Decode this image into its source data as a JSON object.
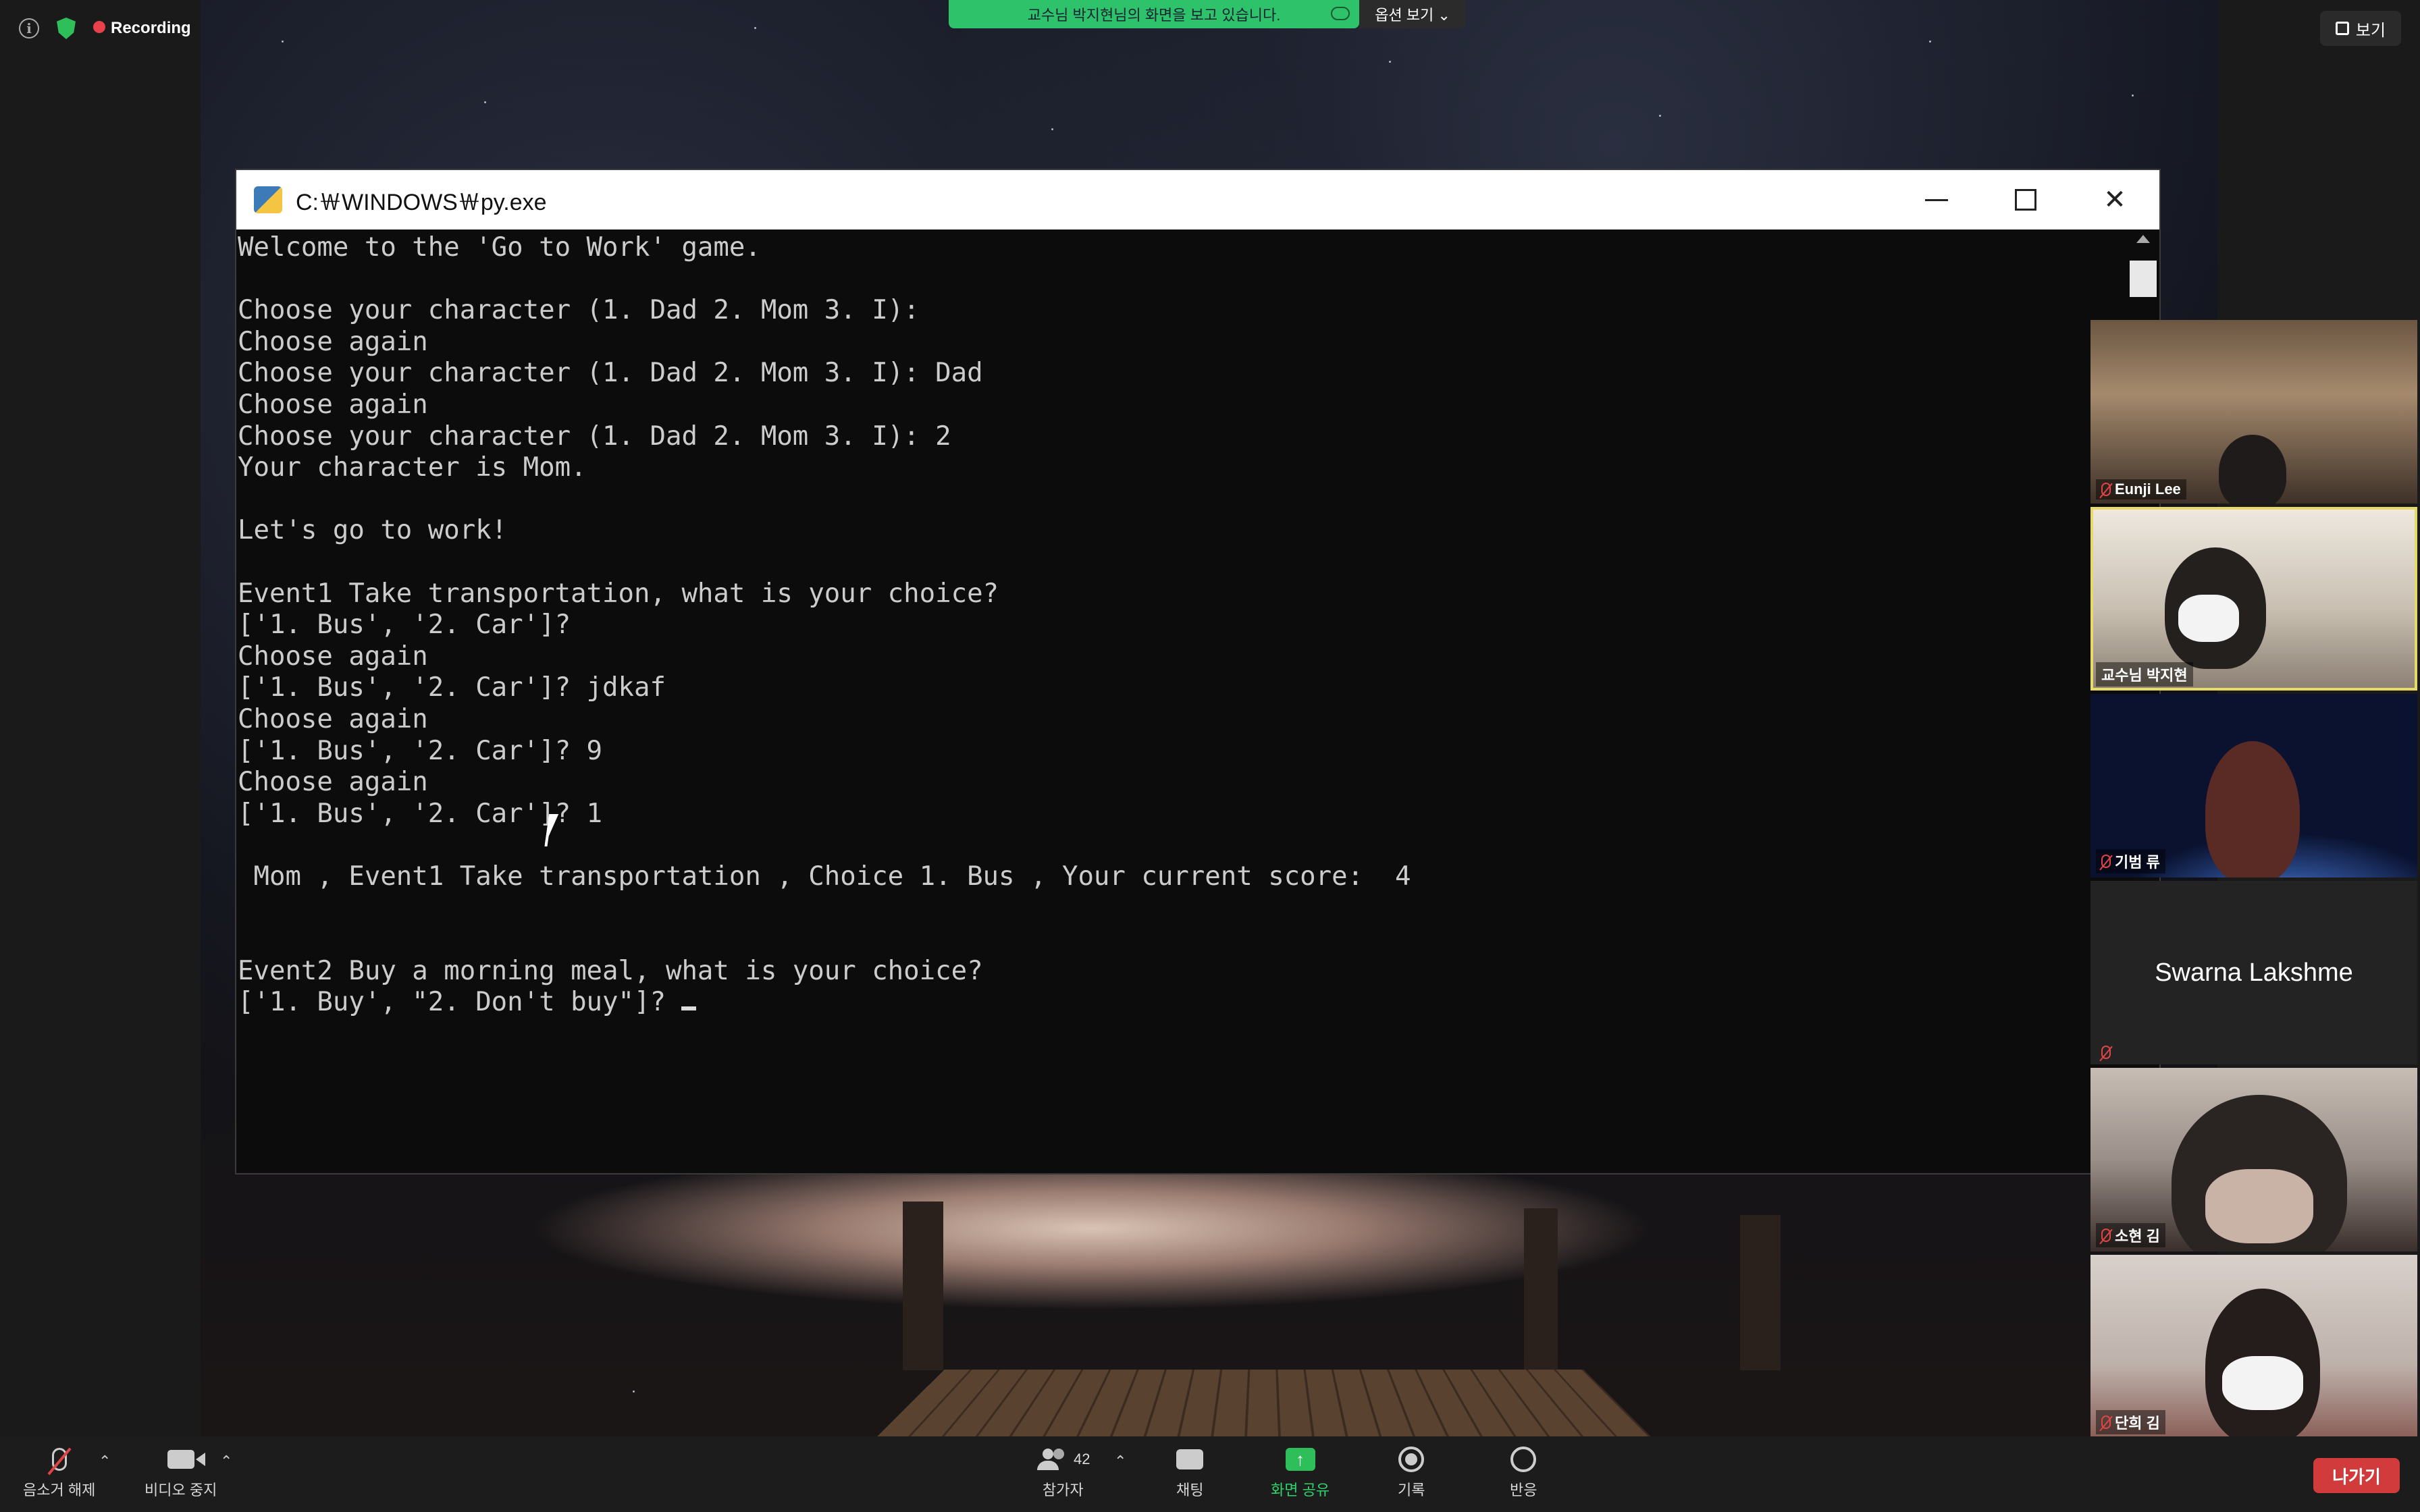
{
  "status": {
    "recording_label": "Recording"
  },
  "share": {
    "banner_text": "교수님 박지현님의 화면을 보고 있습니다.",
    "options_label": "옵션 보기 ⌄",
    "view_label": "보기"
  },
  "console": {
    "title": "C:￦WINDOWS￦py.exe",
    "lines": [
      "Welcome to the 'Go to Work' game.",
      "",
      "Choose your character (1. Dad 2. Mom 3. I):",
      "Choose again",
      "Choose your character (1. Dad 2. Mom 3. I): Dad",
      "Choose again",
      "Choose your character (1. Dad 2. Mom 3. I): 2",
      "Your character is Mom.",
      "",
      "Let's go to work!",
      "",
      "Event1 Take transportation, what is your choice?",
      "['1. Bus', '2. Car']?",
      "Choose again",
      "['1. Bus', '2. Car']? jdkaf",
      "Choose again",
      "['1. Bus', '2. Car']? 9",
      "Choose again",
      "['1. Bus', '2. Car']? 1",
      "",
      " Mom , Event1 Take transportation , Choice 1. Bus , Your current score:  4",
      "",
      "",
      "Event2 Buy a morning meal, what is your choice?",
      "['1. Buy', \"2. Don't buy\"]? "
    ]
  },
  "participants": [
    {
      "name": "Eunji Lee",
      "muted": true
    },
    {
      "name": "교수님 박지현",
      "muted": false,
      "active": true
    },
    {
      "name": "기범 류",
      "muted": true
    },
    {
      "name": "Swarna Lakshme",
      "muted": true,
      "video": false
    },
    {
      "name": "소현 김",
      "muted": true
    },
    {
      "name": "단희 김",
      "muted": true
    }
  ],
  "toolbar": {
    "unmute_label": "음소거 해제",
    "video_label": "비디오 중지",
    "participants_label": "참가자",
    "participants_count": "42",
    "chat_label": "채팅",
    "share_label": "화면 공유",
    "record_label": "기록",
    "reactions_label": "반응",
    "leave_label": "나가기"
  },
  "colors": {
    "share_green": "#2ec26b",
    "leave_red": "#d23b3b",
    "terminal_bg": "#0c0c0c",
    "terminal_text": "#cccccc"
  }
}
